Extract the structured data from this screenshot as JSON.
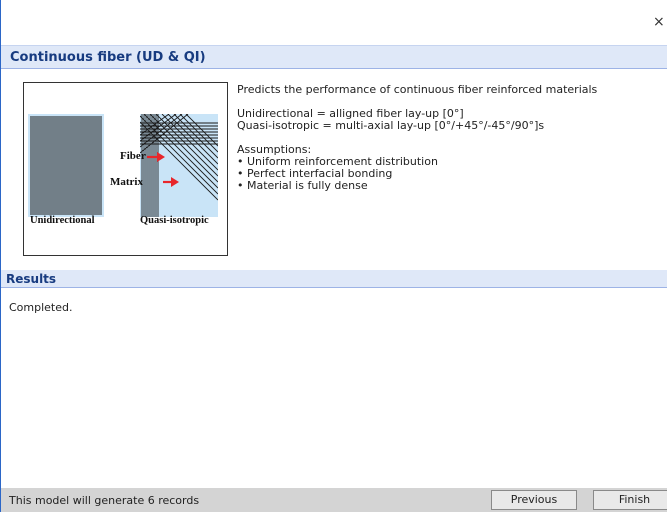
{
  "window": {
    "close_glyph": "×"
  },
  "model": {
    "title": "Continuous fiber (UD & QI)",
    "image": {
      "fiber_label": "Fiber",
      "matrix_label": "Matrix",
      "ud_label": "Unidirectional",
      "qi_label": "Quasi-isotropic"
    },
    "description": {
      "summary": "Predicts the performance of continuous fiber reinforced materials",
      "ud_definition": "Unidirectional = alligned fiber lay-up [0°]",
      "qi_definition": "Quasi-isotropic = multi-axial lay-up [0°/+45°/-45°/90°]s",
      "assumptions_title": "Assumptions:",
      "assumptions": [
        "• Uniform reinforcement distribution",
        "• Perfect interfacial bonding",
        "• Material is fully dense"
      ]
    }
  },
  "results": {
    "title": "Results",
    "status": "Completed."
  },
  "footer": {
    "records_text": "This model will generate 6 records",
    "previous_label": "Previous",
    "finish_label": "Finish"
  },
  "colors": {
    "header_bg": "#dfe8f8",
    "header_text": "#173b80",
    "accent_border": "#2b66c7",
    "arrow_red": "#e8262b",
    "panel_blue": "#c9e4f7"
  }
}
